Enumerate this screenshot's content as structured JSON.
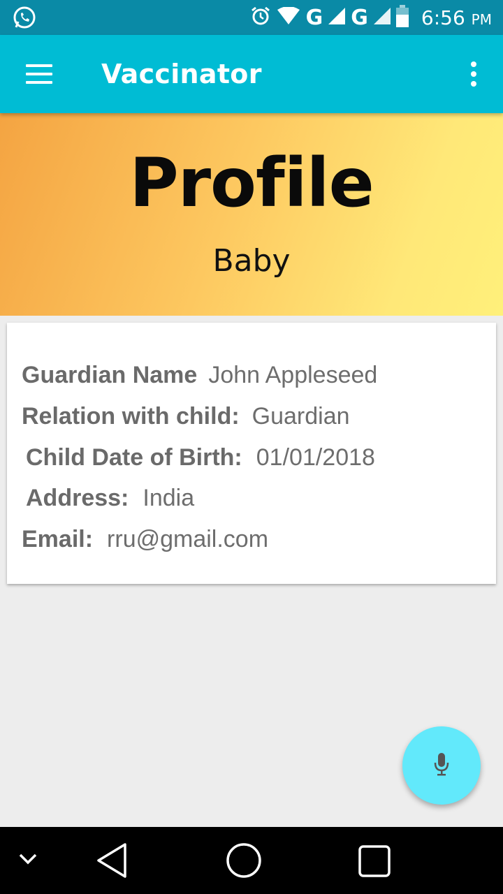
{
  "status_bar": {
    "network_1": "G",
    "network_2": "G",
    "time": "6:56",
    "ampm": "PM"
  },
  "app_bar": {
    "title": "Vaccinator",
    "menu_icon": "hamburger-menu-icon",
    "overflow_icon": "more-vert-icon"
  },
  "header": {
    "title": "Profile",
    "subtitle": "Baby",
    "gradient_start": "#f4a442",
    "gradient_end": "#fff07a"
  },
  "profile": {
    "guardian_name": {
      "label": "Guardian Name",
      "value": "John Appleseed"
    },
    "relation": {
      "label": "Relation with child:",
      "value": "Guardian"
    },
    "dob": {
      "label": "Child Date of Birth:",
      "value": "01/01/2018"
    },
    "address": {
      "label": "Address:",
      "value": "India"
    },
    "email": {
      "label": "Email:",
      "value": "rru@gmail.com"
    }
  },
  "fab": {
    "icon": "microphone-icon",
    "color": "#62e9fb"
  },
  "colors": {
    "status_bar": "#0a8aa6",
    "app_bar": "#00bcd4",
    "background": "#ededed"
  }
}
